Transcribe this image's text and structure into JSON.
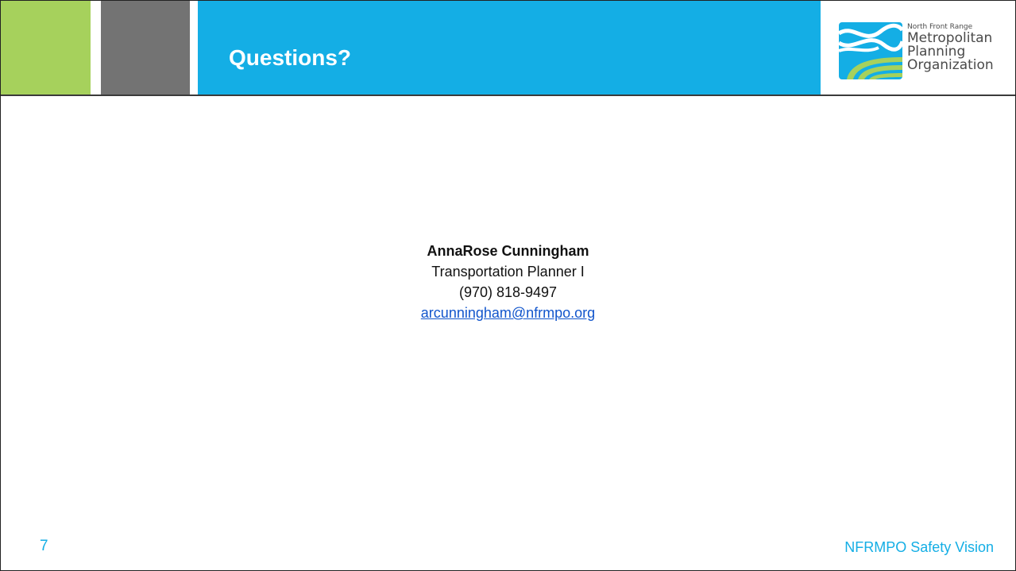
{
  "colors": {
    "accent_green": "#a6d15c",
    "accent_gray": "#737373",
    "title_blue": "#14aee5",
    "link_blue": "#1155cc"
  },
  "header": {
    "title": "Questions?"
  },
  "logo": {
    "line1": "North Front Range",
    "line2": "Metropolitan",
    "line3": "Planning",
    "line4": "Organization",
    "icon": "nfrmpo-logo-icon"
  },
  "contact": {
    "name": "AnnaRose Cunningham",
    "role": "Transportation Planner I",
    "phone": "(970) 818-9497",
    "email": "arcunningham@nfrmpo.org"
  },
  "footer": {
    "page_number": "7",
    "title": "NFRMPO Safety Vision"
  }
}
